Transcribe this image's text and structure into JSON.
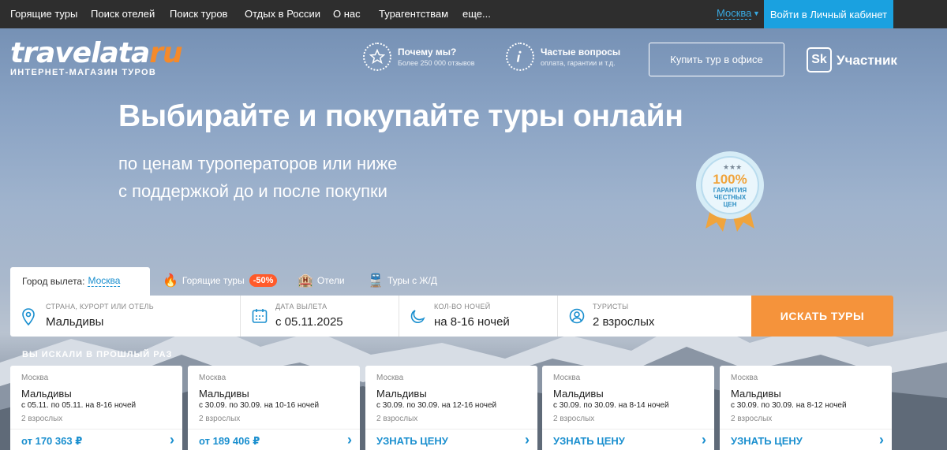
{
  "topnav": {
    "items": [
      "Горящие туры",
      "Поиск отелей",
      "Поиск туров",
      "Отдых в России",
      "О нас",
      "Турагентствам",
      "еще..."
    ],
    "city": "Москва",
    "login": "Войти в Личный кабинет"
  },
  "logo": {
    "wordmark_main": "travelata",
    "wordmark_tld": "ru",
    "tagline": "ИНТЕРНЕТ-МАГАЗИН ТУРОВ"
  },
  "header": {
    "why_title": "Почему мы?",
    "why_sub": "Более 250 000 отзывов",
    "faq_title": "Частые вопросы",
    "faq_sub": "оплата, гарантии и т.д.",
    "buy_office": "Купить тур в офисе",
    "sk_badge": "Sk",
    "sk_label": "Участник"
  },
  "hero": {
    "title": "Выбирайте и покупайте туры онлайн",
    "sub1": "по ценам туроператоров или ниже",
    "sub2": "с поддержкой до и после покупки"
  },
  "seal": {
    "line1": "100%",
    "line2": "ГАРАНТИЯ",
    "line3": "ЧЕСТНЫХ",
    "line4": "ЦЕН"
  },
  "tabs": {
    "city_label": "Город вылета:",
    "city_value": "Москва",
    "hot": "Горящие туры",
    "hot_badge": "-50%",
    "hotels": "Отели",
    "rail": "Туры с Ж/Д"
  },
  "search": {
    "dest_label": "СТРАНА, КУРОРТ ИЛИ ОТЕЛЬ",
    "dest_value": "Мальдивы",
    "date_label": "ДАТА ВЫЛЕТА",
    "date_value": "с 05.11.2025",
    "nights_label": "КОЛ-ВО НОЧЕЙ",
    "nights_value": "на 8-16 ночей",
    "tourists_label": "ТУРИСТЫ",
    "tourists_value": "2 взрослых",
    "button": "ИСКАТЬ ТУРЫ"
  },
  "recent": {
    "heading": "ВЫ ИСКАЛИ В ПРОШЛЫЙ РАЗ",
    "cards": [
      {
        "from": "Москва",
        "dest": "Мальдивы",
        "dates": "с 05.11. по 05.11. на 8-16 ночей",
        "pax": "2 взрослых",
        "price": "от 170 363 ₽"
      },
      {
        "from": "Москва",
        "dest": "Мальдивы",
        "dates": "с 30.09. по 30.09. на 10-16 ночей",
        "pax": "2 взрослых",
        "price": "от 189 406 ₽"
      },
      {
        "from": "Москва",
        "dest": "Мальдивы",
        "dates": "с 30.09. по 30.09. на 12-16 ночей",
        "pax": "2 взрослых",
        "price": "УЗНАТЬ ЦЕНУ"
      },
      {
        "from": "Москва",
        "dest": "Мальдивы",
        "dates": "с 30.09. по 30.09. на 8-14 ночей",
        "pax": "2 взрослых",
        "price": "УЗНАТЬ ЦЕНУ"
      },
      {
        "from": "Москва",
        "dest": "Мальдивы",
        "dates": "с 30.09. по 30.09. на 8-12 ночей",
        "pax": "2 взрослых",
        "price": "УЗНАТЬ ЦЕНУ"
      }
    ]
  },
  "colors": {
    "topbar": "#2e2e2e",
    "login": "#1aa1e0",
    "accent_orange": "#f5933b",
    "link_blue": "#1a8fcf"
  }
}
